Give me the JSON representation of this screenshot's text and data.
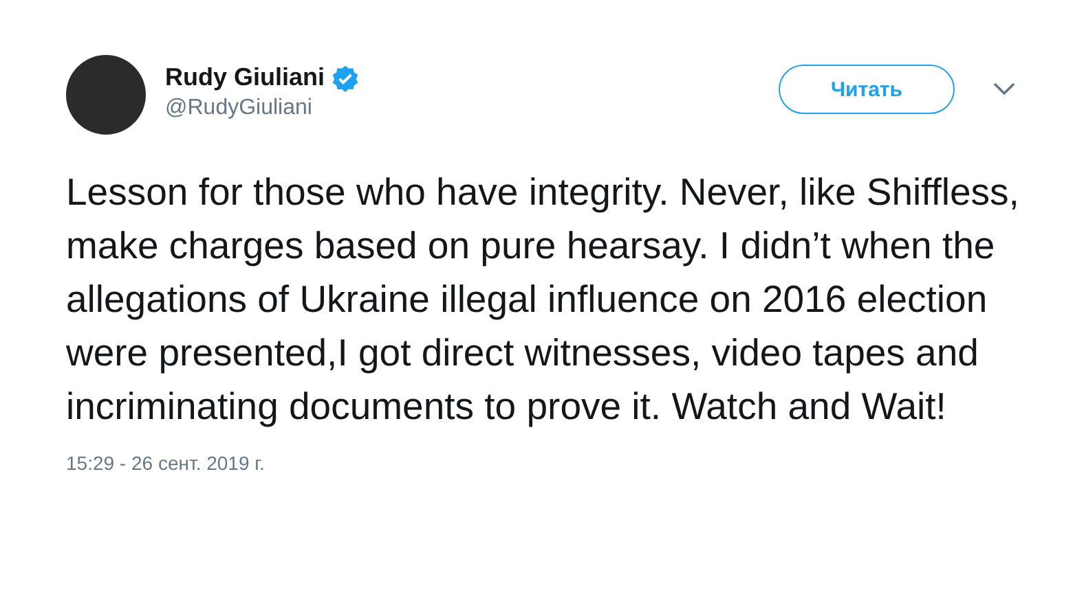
{
  "author": {
    "name": "Rudy Giuliani",
    "verified": true,
    "handle": "@RudyGiuliani"
  },
  "follow_button": {
    "label": "Читать"
  },
  "tweet": {
    "text": "Lesson for those who have integrity. Never, like Shiffless,  make charges based on pure hearsay. I didn’t when the allegations of Ukraine illegal influence on 2016 election were presented,I got direct witnesses, video tapes and incriminating documents to prove it. Watch and Wait!"
  },
  "timestamp": "15:29 - 26 сент. 2019 г."
}
